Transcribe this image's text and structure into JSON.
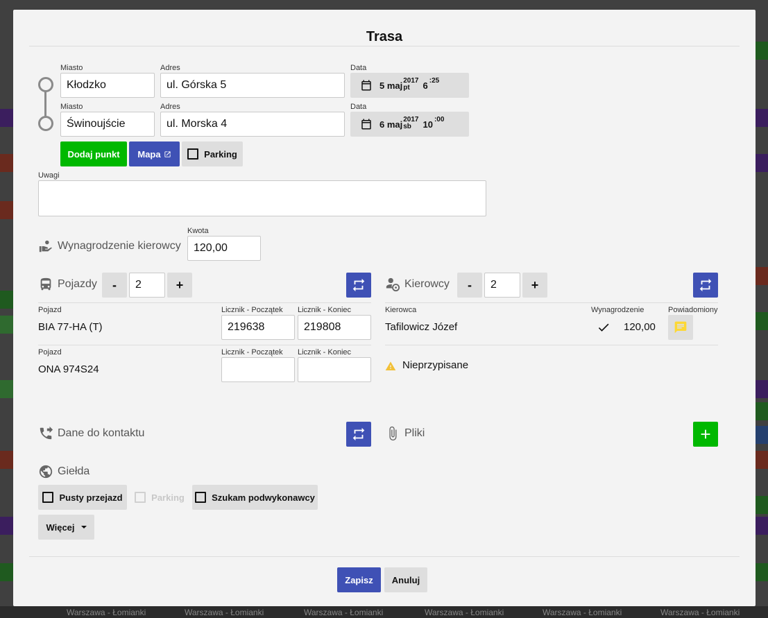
{
  "dialog": {
    "title": "Trasa"
  },
  "route": {
    "labels": {
      "city": "Miasto",
      "address": "Adres",
      "date": "Data"
    },
    "points": [
      {
        "city": "Kłodzko",
        "address": "ul. Górska 5",
        "day": "5 maj",
        "year": "2017",
        "weekday": "pt",
        "hour": "6",
        "minute": ":25"
      },
      {
        "city": "Świnoujście",
        "address": "ul. Morska 4",
        "day": "6 maj",
        "year": "2017",
        "weekday": "sb",
        "hour": "10",
        "minute": ":00"
      }
    ],
    "buttons": {
      "add_point": "Dodaj punkt",
      "map": "Mapa",
      "parking": "Parking"
    }
  },
  "notes": {
    "label": "Uwagi",
    "value": ""
  },
  "driver_pay": {
    "section": "Wynagrodzenie kierowcy",
    "amount_label": "Kwota",
    "amount": "120,00"
  },
  "vehicles": {
    "section": "Pojazdy",
    "count": "2",
    "minus": "-",
    "plus": "+",
    "col_vehicle": "Pojazd",
    "col_start": "Licznik - Początek",
    "col_end": "Licznik - Koniec",
    "rows": [
      {
        "name": "BIA 77-HA (T)",
        "start": "219638",
        "end": "219808"
      },
      {
        "name": "ONA 974S24",
        "start": "",
        "end": ""
      }
    ]
  },
  "drivers": {
    "section": "Kierowcy",
    "count": "2",
    "minus": "-",
    "plus": "+",
    "col_driver": "Kierowca",
    "col_pay": "Wynagrodzenie",
    "col_notified": "Powiadomiony",
    "rows": [
      {
        "name": "Tafilowicz Józef",
        "pay": "120,00"
      }
    ],
    "unassigned": "Nieprzypisane"
  },
  "contact": {
    "section": "Dane do kontaktu"
  },
  "files": {
    "section": "Pliki"
  },
  "exchange": {
    "section": "Giełda",
    "options": {
      "empty_run": "Pusty przejazd",
      "parking": "Parking",
      "subcontractor": "Szukam podwykonawcy"
    },
    "more": "Więcej"
  },
  "footer": {
    "save": "Zapisz",
    "cancel": "Anuluj"
  },
  "background": {
    "row_label": "Warszawa - Łomianki"
  },
  "colors": {
    "primary": "#3f51b5",
    "success": "#00b800",
    "notice": "#fdd835",
    "warning": "#f2c037"
  }
}
